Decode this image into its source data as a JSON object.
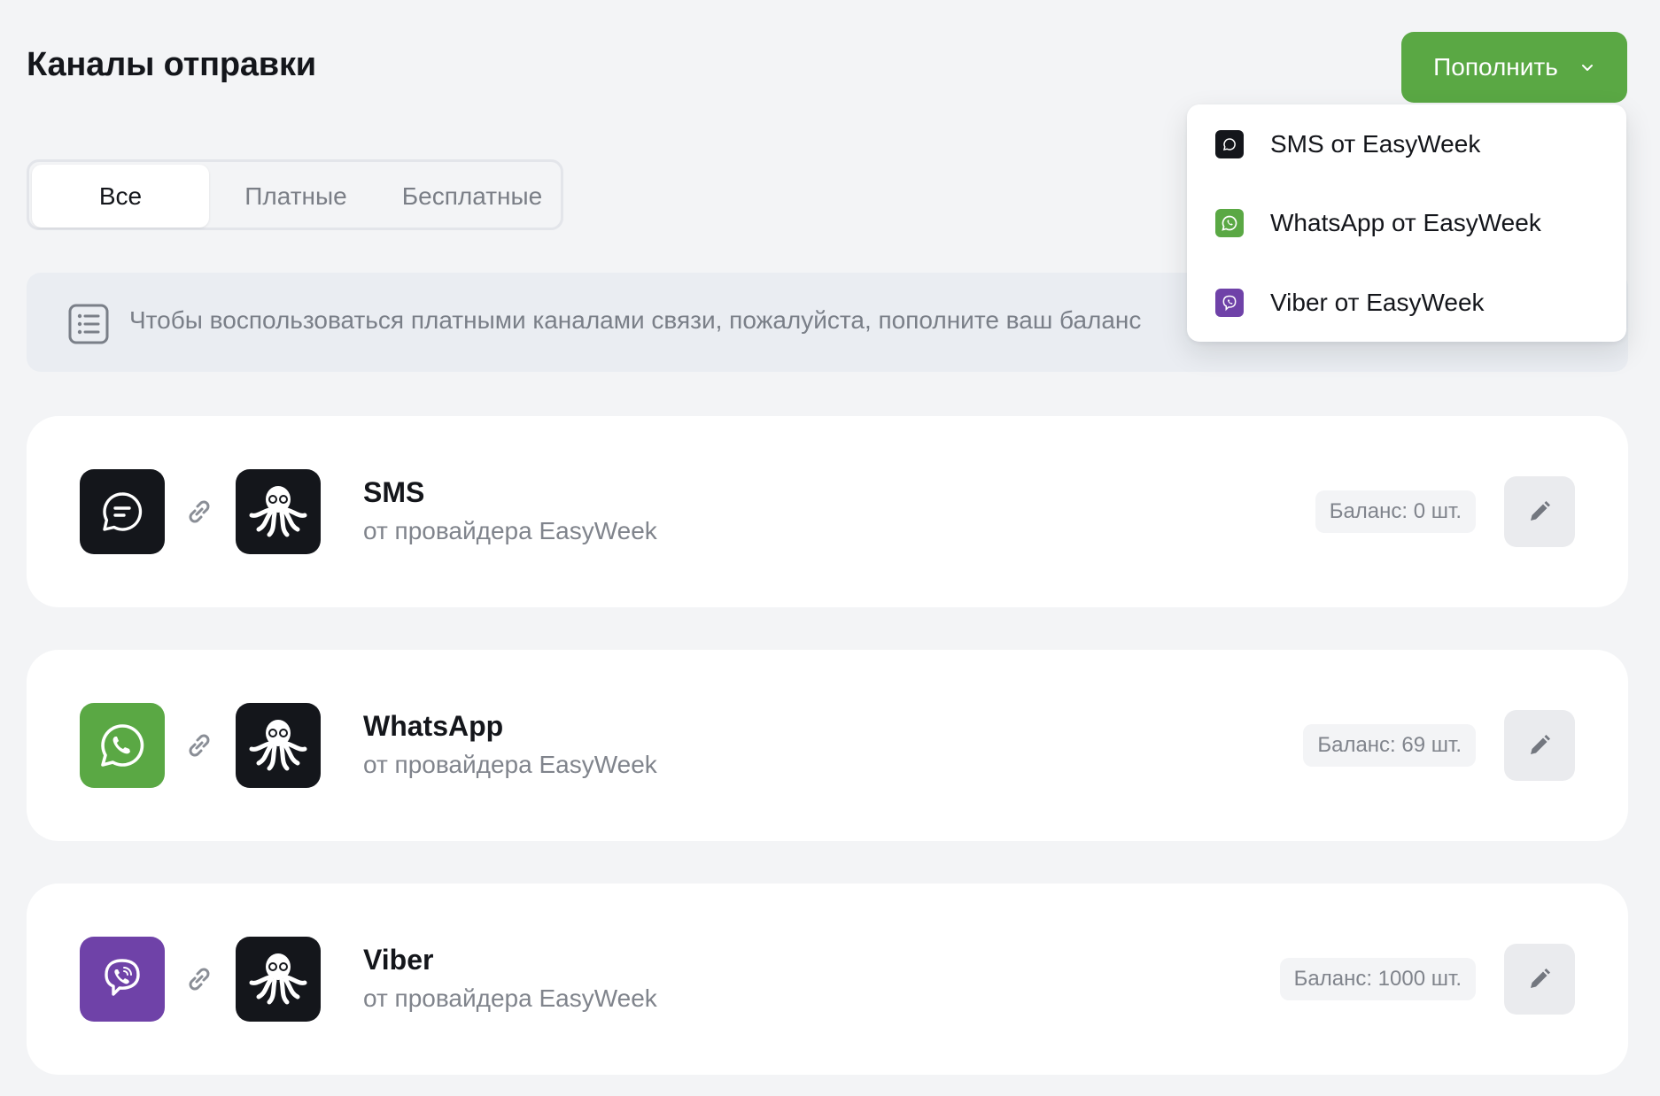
{
  "page": {
    "title": "Каналы отправки"
  },
  "topup": {
    "label": "Пополнить",
    "icon": "chevron-down-icon"
  },
  "dropdown": {
    "items": [
      {
        "label": "SMS от EasyWeek",
        "icon": "sms-icon",
        "color": "#14161b"
      },
      {
        "label": "WhatsApp от EasyWeek",
        "icon": "whatsapp-icon",
        "color": "#5aa844"
      },
      {
        "label": "Viber от EasyWeek",
        "icon": "viber-icon",
        "color": "#6f42a8"
      }
    ]
  },
  "tabs": [
    {
      "label": "Все",
      "active": true
    },
    {
      "label": "Платные",
      "active": false
    },
    {
      "label": "Бесплатные",
      "active": false
    }
  ],
  "notice": {
    "icon": "list-icon",
    "text": "Чтобы воспользоваться платными каналами связи, пожалуйста, пополните ваш баланс"
  },
  "channels": [
    {
      "name": "SMS",
      "subtitle": "от провайдера EasyWeek",
      "balance": "Баланс: 0 шт.",
      "icon": "sms-icon",
      "color": "#14161b"
    },
    {
      "name": "WhatsApp",
      "subtitle": "от провайдера EasyWeek",
      "balance": "Баланс: 69 шт.",
      "icon": "whatsapp-icon",
      "color": "#5aa844"
    },
    {
      "name": "Viber",
      "subtitle": "от провайдера EasyWeek",
      "balance": "Баланс: 1000 шт.",
      "icon": "viber-icon",
      "color": "#6f42a8"
    }
  ],
  "colors": {
    "accent": "#5aa844",
    "background": "#f3f4f6",
    "notice_bg": "#eaedf2"
  }
}
